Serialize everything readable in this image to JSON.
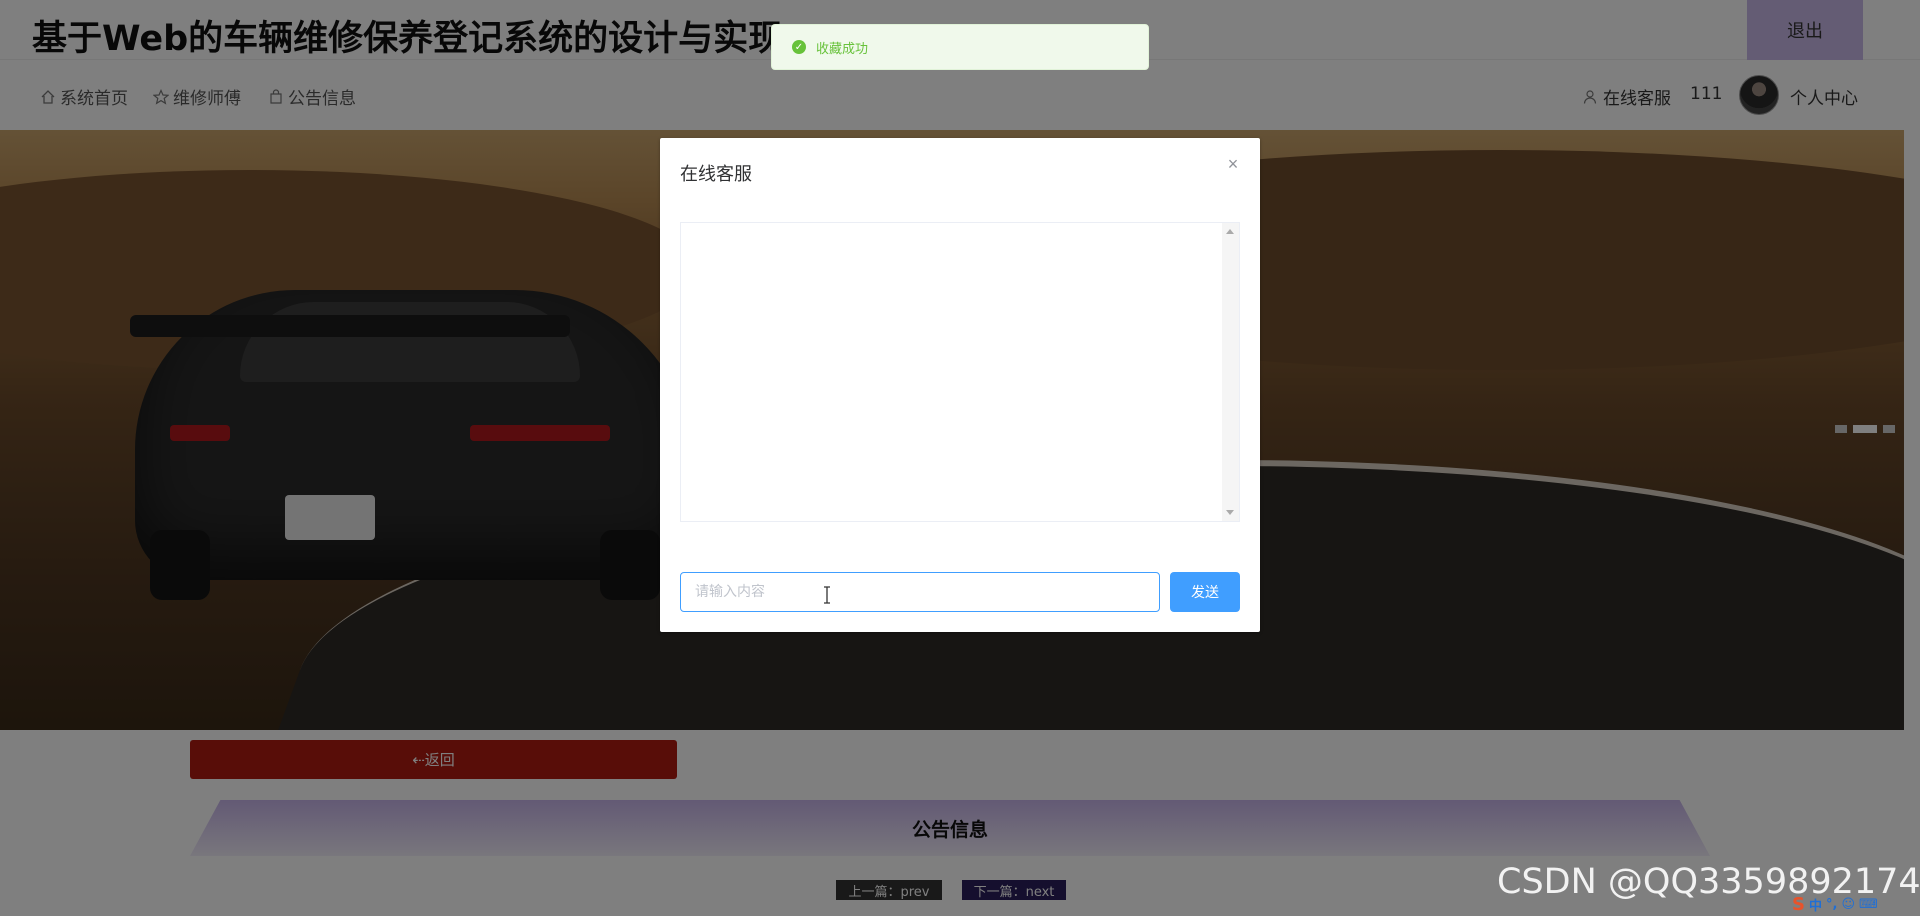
{
  "app": {
    "title": "基于Web的车辆维修保养登记系统的设计与实现"
  },
  "header": {
    "logout_label": "退出"
  },
  "nav": {
    "items": [
      {
        "label": "系统首页",
        "icon": "home-icon"
      },
      {
        "label": "维修师傅",
        "icon": "star-icon"
      },
      {
        "label": "公告信息",
        "icon": "bag-icon"
      }
    ],
    "customer_service_label": "在线客服",
    "username": "111",
    "profile_label": "个人中心"
  },
  "hero": {
    "carousel_count": 3,
    "active_index": 1
  },
  "detail": {
    "back_label": "⇠返回",
    "section_title": "公告信息",
    "prev_label": "上一篇：prev",
    "next_label": "下一篇：next"
  },
  "toast": {
    "message": "收藏成功",
    "type": "success"
  },
  "dialog": {
    "title": "在线客服",
    "input_placeholder": "请输入内容",
    "input_value": "",
    "send_label": "发送"
  },
  "watermark": {
    "text": "CSDN @QQ3359892174"
  },
  "ime": {
    "items": [
      "中",
      "°,",
      "☺",
      "⌨"
    ]
  },
  "colors": {
    "primary": "#409eff",
    "danger": "#b01a10",
    "accent_purple": "#c7b4ea",
    "success": "#67c23a"
  }
}
